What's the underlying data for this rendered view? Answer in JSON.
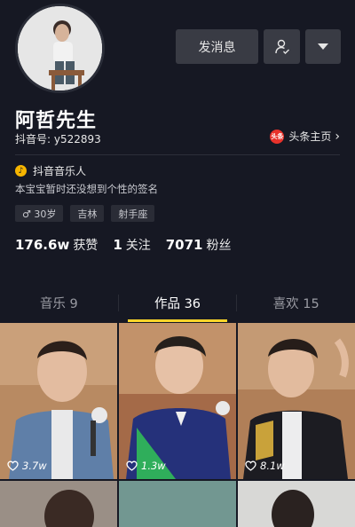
{
  "profile": {
    "name": "阿哲先生",
    "douyin_id": "抖音号: y522893",
    "toutiao_label": "头条主页",
    "toutiao_logo_text": "头条",
    "verified_label": "抖音音乐人",
    "bio": "本宝宝暂时还没想到个性的签名"
  },
  "actions": {
    "message_label": "发消息"
  },
  "tags": [
    "♂ 30岁",
    "吉林",
    "射手座"
  ],
  "stats": [
    {
      "value": "176.6w",
      "label": "获赞"
    },
    {
      "value": "1",
      "label": "关注"
    },
    {
      "value": "7071",
      "label": "粉丝"
    }
  ],
  "tabs": [
    {
      "label": "音乐 9"
    },
    {
      "label": "作品 36"
    },
    {
      "label": "喜欢 15"
    }
  ],
  "active_tab": 1,
  "videos": [
    {
      "likes": "3.7w"
    },
    {
      "likes": "1.3w"
    },
    {
      "likes": "8.1w"
    }
  ],
  "colors": {
    "background": "#161823",
    "tab_indicator": "#fbd52a",
    "button": "#393b44",
    "toutiao_red": "#e8322b",
    "verified_yellow": "#f6b500"
  }
}
